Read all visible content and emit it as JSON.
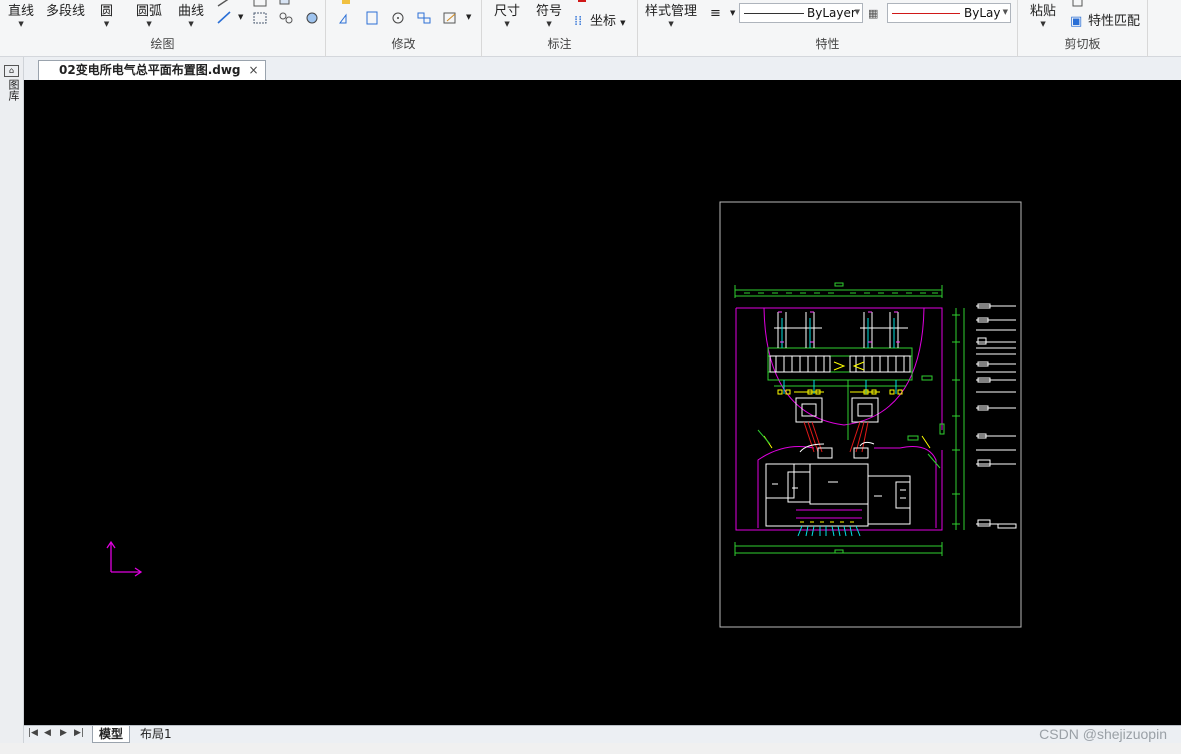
{
  "ribbon": {
    "draw": {
      "title": "绘图",
      "line": "直线",
      "polyline": "多段线",
      "circle": "圆",
      "arc": "圆弧",
      "curve": "曲线"
    },
    "modify": {
      "title": "修改"
    },
    "annotate": {
      "title": "标注",
      "dimension": "尺寸",
      "symbol": "符号",
      "coordinate": "坐标"
    },
    "properties": {
      "title": "特性",
      "style_manager": "样式管理",
      "linetype_value": "ByLayer",
      "color_value": "ByLayer"
    },
    "clipboard": {
      "title": "剪切板",
      "paste": "粘贴",
      "match_properties": "特性匹配"
    }
  },
  "sidebar": {
    "label": "图库"
  },
  "document": {
    "tab_title": "02变电所电气总平面布置图.dwg",
    "close": "×"
  },
  "layout_tabs": {
    "model": "模型",
    "layout1": "布局1"
  },
  "watermark": "CSDN @shejizuopin",
  "colors": {
    "canvas": "#000000",
    "ucs": "#e000e0",
    "accent_red": "#d01818"
  }
}
